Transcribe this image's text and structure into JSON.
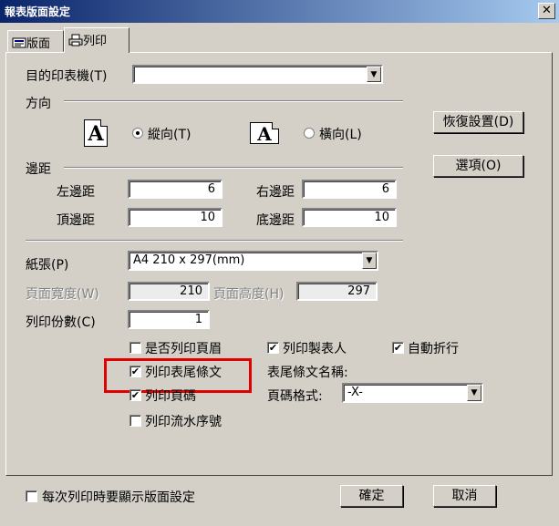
{
  "window": {
    "title": "報表版面設定",
    "close_glyph": "✕"
  },
  "tabs": [
    {
      "label": "版面",
      "icon": "layout-icon"
    },
    {
      "label": "列印",
      "icon": "printer-icon"
    }
  ],
  "printer": {
    "label": "目的印表機(T)",
    "value": ""
  },
  "orientation": {
    "section": "方向",
    "portrait_label": "縱向(T)",
    "landscape_label": "橫向(L)",
    "icon_letter": "A",
    "selected": "portrait"
  },
  "margins": {
    "section": "邊距",
    "left_label": "左邊距",
    "left_value": "6",
    "right_label": "右邊距",
    "right_value": "6",
    "top_label": "頂邊距",
    "top_value": "10",
    "bottom_label": "底邊距",
    "bottom_value": "10"
  },
  "buttons": {
    "restore": "恢復設置(D)",
    "options": "選項(O)",
    "ok": "確定",
    "cancel": "取消"
  },
  "paper": {
    "label": "紙張(P)",
    "value": "A4 210 x 297(mm)",
    "width_label": "頁面寬度(W)",
    "width_value": "210",
    "height_label": "頁面高度(H)",
    "height_value": "297",
    "copies_label": "列印份數(C)",
    "copies_value": "1"
  },
  "options": {
    "print_header": {
      "label": "是否列印頁眉",
      "checked": false
    },
    "print_footer": {
      "label": "列印表尾條文",
      "checked": true
    },
    "print_page_no": {
      "label": "列印頁碼",
      "checked": true
    },
    "print_serial": {
      "label": "列印流水序號",
      "checked": false
    },
    "print_maker": {
      "label": "列印製表人",
      "checked": true
    },
    "auto_wrap": {
      "label": "自動折行",
      "checked": true
    },
    "footer_name_label": "表尾條文名稱:",
    "page_format_label": "頁碼格式:",
    "page_format_value": "-X-"
  },
  "footer": {
    "show_settings_label": "每次列印時要顯示版面設定",
    "checked": false
  },
  "colors": {
    "titlebar_start": "#0a246a",
    "titlebar_end": "#a6caf0",
    "highlight": "#e00000"
  }
}
